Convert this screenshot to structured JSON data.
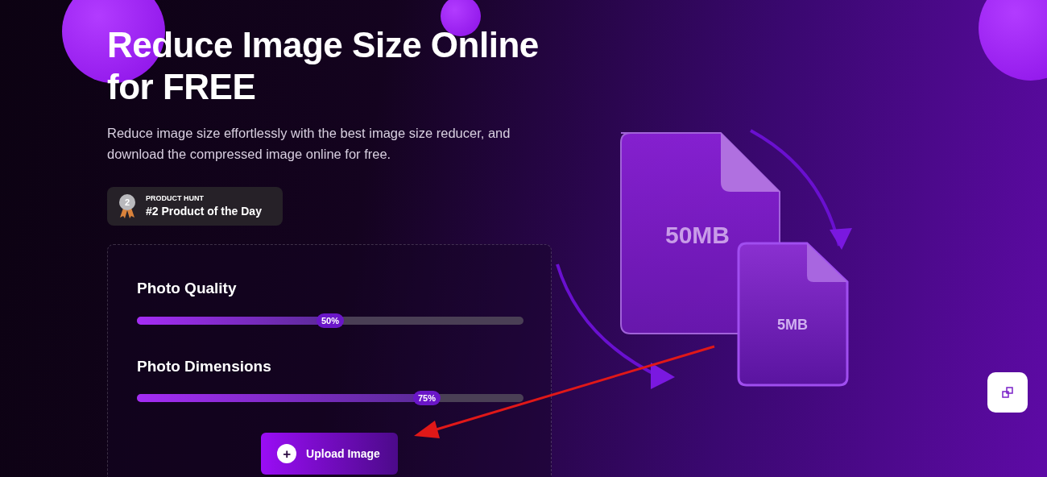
{
  "hero": {
    "title_lines": [
      "Reduce Image Size Online",
      "for FREE"
    ],
    "description": "Reduce image size effortlessly with the best image size reducer, and download the compressed image online for free."
  },
  "award": {
    "rank": "2",
    "eyebrow": "PRODUCT HUNT",
    "title": "#2 Product of the Day"
  },
  "sliders": [
    {
      "label": "Photo Quality",
      "level": 0.5,
      "reading": "50%"
    },
    {
      "label": "Photo Dimensions",
      "level": 0.75,
      "reading": "75%"
    }
  ],
  "upload_button": {
    "icon": "+",
    "label": "Upload Image"
  },
  "illustration": {
    "large_file": "50MB",
    "small_file": "5MB"
  }
}
